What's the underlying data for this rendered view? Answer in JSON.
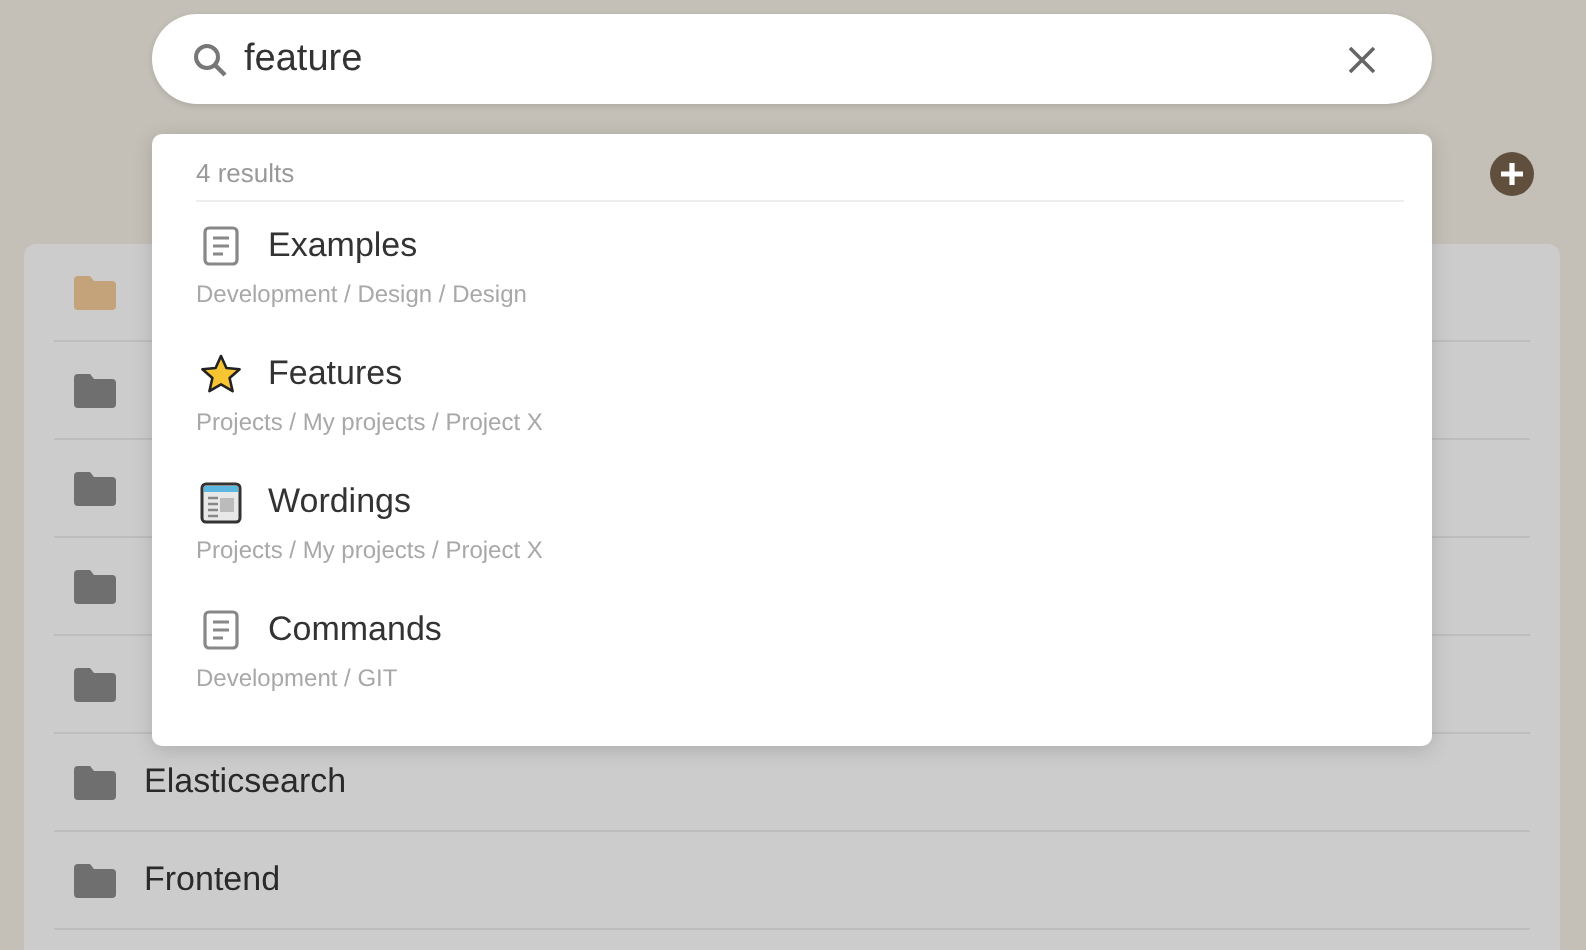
{
  "search": {
    "value": "feature"
  },
  "folders": [
    {
      "color": "#c4a27a"
    },
    {
      "color": "#6f6f6f"
    },
    {
      "color": "#6f6f6f"
    },
    {
      "color": "#6f6f6f"
    },
    {
      "color": "#6f6f6f"
    },
    {
      "name": "Elasticsearch",
      "color": "#6f6f6f"
    },
    {
      "name": "Frontend",
      "color": "#6f6f6f"
    }
  ],
  "results": {
    "count": "4 results",
    "items": [
      {
        "kind": "page",
        "title": "Examples",
        "path": "Development / Design / Design"
      },
      {
        "kind": "star",
        "title": "Features",
        "path": "Projects / My projects / Project X"
      },
      {
        "kind": "sheet",
        "title": "Wordings",
        "path": "Projects / My projects / Project X"
      },
      {
        "kind": "page",
        "title": "Commands",
        "path": "Development / GIT"
      }
    ]
  }
}
